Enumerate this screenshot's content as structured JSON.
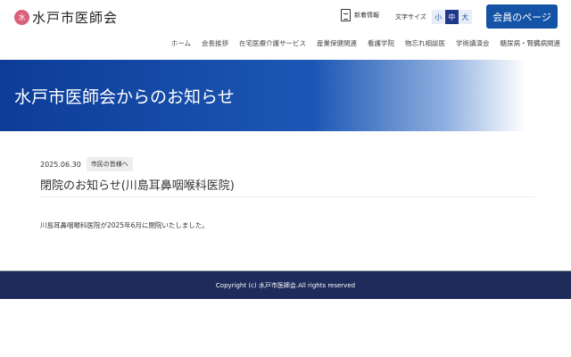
{
  "header": {
    "logo_mark": "水",
    "logo_text": "水戸市医師会",
    "news_label": "新着情報",
    "font_size_label": "文字サイズ",
    "font_sizes": [
      "小",
      "中",
      "大"
    ],
    "member_button": "会員のページ"
  },
  "nav": [
    "ホーム",
    "会長挨拶",
    "在宅医療介護サービス",
    "産業保健関連",
    "看護学院",
    "物忘れ相談医",
    "学術講演会",
    "糖尿病・腎臓病関連"
  ],
  "hero": {
    "title": "水戸市医師会からのお知らせ"
  },
  "article": {
    "date": "2025.06.30",
    "category": "市民の皆様へ",
    "title": "閉院のお知らせ(川島耳鼻咽喉科医院)",
    "body": "川島耳鼻咽喉科医院が2025年6月に閉院いたしました。"
  },
  "footer": {
    "copyright": "Copyright (c) 水戸市医師会.All rights reserved"
  }
}
